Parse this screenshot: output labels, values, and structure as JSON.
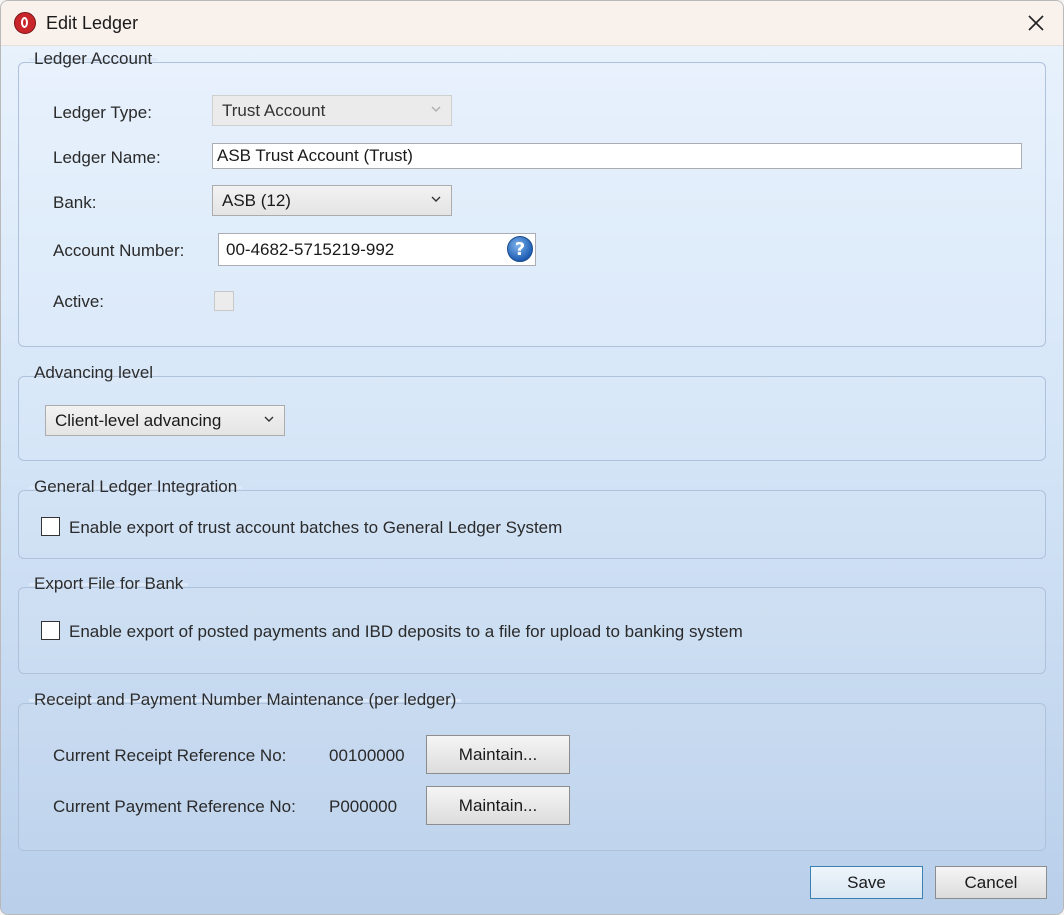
{
  "window": {
    "title": "Edit Ledger"
  },
  "ledger_account": {
    "legend": "Ledger Account",
    "ledger_type_label": "Ledger Type:",
    "ledger_type_value": "Trust Account",
    "ledger_name_label": "Ledger Name:",
    "ledger_name_value": "ASB Trust Account (Trust)",
    "bank_label": "Bank:",
    "bank_value": "ASB (12)",
    "account_number_label": "Account Number:",
    "account_number_value": "00-4682-5715219-992",
    "help_glyph": "?",
    "active_label": "Active:",
    "active_checked": false
  },
  "advancing": {
    "legend": "Advancing level",
    "value": "Client-level advancing"
  },
  "gl_integration": {
    "legend": "General Ledger Integration",
    "checkbox_label": "Enable export of trust account batches to General Ledger System",
    "checked": false
  },
  "export_file": {
    "legend": "Export File for Bank",
    "checkbox_label": "Enable export of posted payments and IBD deposits to a file for upload to banking system",
    "checked": false
  },
  "numbers": {
    "legend": "Receipt and Payment Number Maintenance (per ledger)",
    "receipt_label": "Current Receipt Reference No:",
    "receipt_value": "00100000",
    "payment_label": "Current Payment Reference No:",
    "payment_value": "P000000",
    "maintain_label": "Maintain..."
  },
  "footer": {
    "save_label": "Save",
    "cancel_label": "Cancel"
  },
  "icons": {
    "app": "app-logo-icon",
    "close": "close-icon",
    "help": "help-icon",
    "chevron": "chevron-down-icon"
  },
  "colors": {
    "accent": "#3c7fb1",
    "app_icon": "#c8262a"
  }
}
